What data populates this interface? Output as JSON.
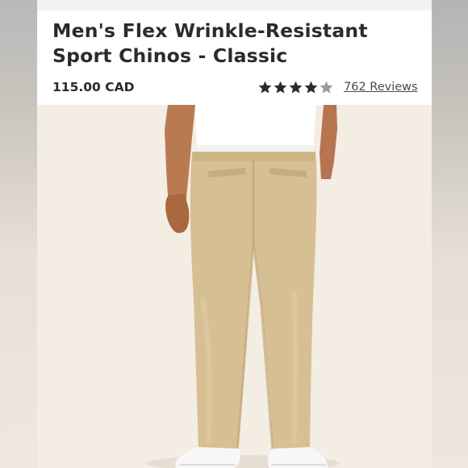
{
  "product": {
    "title_line1": "Men's Flex Wrinkle-Resistant",
    "title_line2": "Sport Chinos - Classic",
    "price": "115.00 CAD",
    "rating": {
      "stars_filled": 4,
      "stars_total": 5,
      "reviews_label": "762 Reviews"
    },
    "image": {
      "subject": "khaki-chinos-rear-view"
    }
  },
  "colors": {
    "text": "#2b2b2b",
    "star_filled": "#2b2b2b",
    "star_empty": "#9b9b9b",
    "pants": "#d7bf94",
    "shirt": "#ffffff",
    "skin": "#b97a52",
    "background": "#f3ede4"
  }
}
